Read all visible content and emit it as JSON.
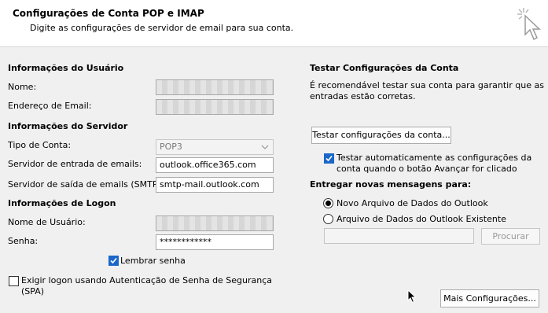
{
  "header": {
    "title": "Configurações de Conta POP e IMAP",
    "subtitle": "Digite as configurações de servidor de email para sua conta."
  },
  "user_info": {
    "section_title": "Informações do Usuário",
    "name_label": "Nome:",
    "email_label": "Endereço de Email:"
  },
  "server_info": {
    "section_title": "Informações do Servidor",
    "account_type_label": "Tipo de Conta:",
    "account_type_value": "POP3",
    "incoming_label": "Servidor de entrada de emails:",
    "incoming_value": "outlook.office365.com",
    "outgoing_label": "Servidor de saída de emails (SMTP):",
    "outgoing_value": "smtp-mail.outlook.com"
  },
  "logon_info": {
    "section_title": "Informações de Logon",
    "username_label": "Nome de Usuário:",
    "password_label": "Senha:",
    "password_value": "************",
    "remember_label": "Lembrar senha",
    "remember_checked": true,
    "spa_label_line1": "Exigir logon usando Autenticação de Senha de Segurança",
    "spa_label_line2": "(SPA)",
    "spa_checked": false
  },
  "test_settings": {
    "section_title": "Testar Configurações da Conta",
    "description_line1": "É recomendável testar sua conta para garantir que as",
    "description_line2": "entradas estão corretas.",
    "test_button": "Testar configurações da conta...",
    "auto_test_line1": "Testar automaticamente as configurações da",
    "auto_test_line2": "conta quando o botão Avançar for clicado",
    "auto_test_checked": true
  },
  "delivery": {
    "section_title": "Entregar novas mensagens para:",
    "option_new": "Novo Arquivo de Dados do Outlook",
    "option_existing": "Arquivo de Dados do Outlook Existente",
    "selected": "new",
    "browse_button": "Procurar"
  },
  "more_settings_button": "Mais Configurações...",
  "colors": {
    "accent": "#1a67c9",
    "background": "#f0f0f0",
    "header_background": "#ffffff"
  }
}
